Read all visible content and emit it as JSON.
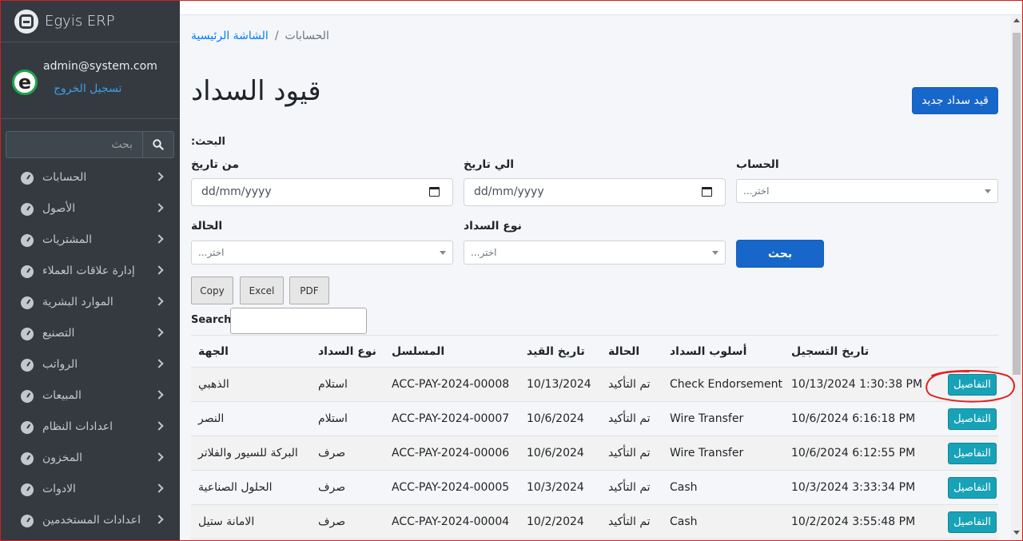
{
  "app": {
    "brand": "Egyis ERP"
  },
  "user": {
    "email": "admin@system.com",
    "logout": "تسجيل الخروج"
  },
  "sidebar": {
    "search_placeholder": "بحث",
    "items": [
      {
        "label": "الحسابات"
      },
      {
        "label": "الأصول"
      },
      {
        "label": "المشتريات"
      },
      {
        "label": "إدارة علاقات العملاء"
      },
      {
        "label": "الموارد البشرية"
      },
      {
        "label": "التصنيع"
      },
      {
        "label": "الرواتب"
      },
      {
        "label": "المبيعات"
      },
      {
        "label": "اعدادات النظام"
      },
      {
        "label": "المخزون"
      },
      {
        "label": "الادوات"
      },
      {
        "label": "اعدادات المستخدمين"
      }
    ]
  },
  "breadcrumb": {
    "home": "الشاشة الرئيسية",
    "separator": "/",
    "current": "الحسابات"
  },
  "page": {
    "title": "قيود السداد",
    "new_button": "قيد سداد جديد"
  },
  "filters": {
    "search_title": ":البحث",
    "from_date": {
      "label": "من تاريخ",
      "value": "dd/mm/yyyy"
    },
    "to_date": {
      "label": "الي تاريخ",
      "value": "dd/mm/yyyy"
    },
    "account": {
      "label": "الحساب",
      "placeholder": "...اختر"
    },
    "status": {
      "label": "الحالة",
      "placeholder": "...اختر"
    },
    "payment_type": {
      "label": "نوع السداد",
      "placeholder": "...اختر"
    },
    "search_button": "بحث"
  },
  "datatable": {
    "buttons": [
      "Copy",
      "Excel",
      "PDF"
    ],
    "search_label": "Search:",
    "columns": [
      "الجهة",
      "نوع السداد",
      "المسلسل",
      "تاريخ القيد",
      "الحالة",
      "أسلوب السداد",
      "تاريخ التسجيل",
      ""
    ],
    "rows": [
      {
        "party": "الذهبي",
        "type": "استلام",
        "serial": "ACC-PAY-2024-00008",
        "date": "10/13/2024",
        "status": "تم التأكيد",
        "method": "Check Endorsement",
        "registered": "10/13/2024 1:30:38 PM",
        "action": "التفاصيل"
      },
      {
        "party": "النصر",
        "type": "استلام",
        "serial": "ACC-PAY-2024-00007",
        "date": "10/6/2024",
        "status": "تم التأكيد",
        "method": "Wire Transfer",
        "registered": "10/6/2024 6:16:18 PM",
        "action": "التفاصيل"
      },
      {
        "party": "البركة للسيور والفلاتر",
        "type": "صرف",
        "serial": "ACC-PAY-2024-00006",
        "date": "10/6/2024",
        "status": "تم التأكيد",
        "method": "Wire Transfer",
        "registered": "10/6/2024 6:12:55 PM",
        "action": "التفاصيل"
      },
      {
        "party": "الحلول الصناعية",
        "type": "صرف",
        "serial": "ACC-PAY-2024-00005",
        "date": "10/3/2024",
        "status": "تم التأكيد",
        "method": "Cash",
        "registered": "10/3/2024 3:33:34 PM",
        "action": "التفاصيل"
      },
      {
        "party": "الامانة ستيل",
        "type": "صرف",
        "serial": "ACC-PAY-2024-00004",
        "date": "10/2/2024",
        "status": "تم التأكيد",
        "method": "Cash",
        "registered": "10/2/2024 3:55:48 PM",
        "action": "التفاصيل"
      }
    ]
  },
  "colors": {
    "sidebar": "#343a40",
    "primary": "#1766c9",
    "info": "#17a2b8",
    "annotation": "#e0201f"
  }
}
